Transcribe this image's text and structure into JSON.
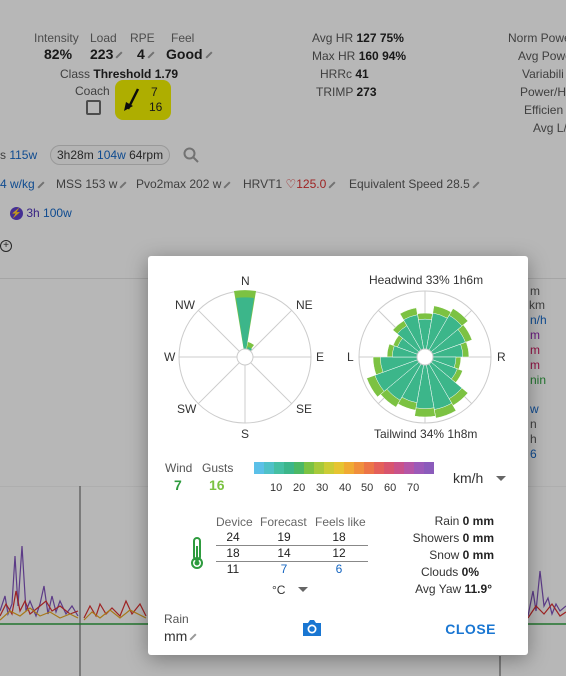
{
  "background": {
    "stats_left": [
      {
        "label": "Intensity",
        "value": "82%"
      },
      {
        "label": "Load",
        "value": "223"
      },
      {
        "label": "RPE",
        "value": "4"
      },
      {
        "label": "Feel",
        "value": "Good"
      }
    ],
    "class_label": "Class",
    "class_value": "Threshold 1.79",
    "coach_label": "Coach",
    "coach_arrow_top": "7",
    "coach_arrow_bottom": "16",
    "hr_rows": [
      {
        "label": "Avg HR",
        "v1": "127",
        "v2": "75%"
      },
      {
        "label": "Max HR",
        "v1": "160",
        "v2": "94%"
      },
      {
        "label": "HRRc",
        "v1": "41",
        "v2": ""
      },
      {
        "label": "TRIMP",
        "v1": "273",
        "v2": ""
      }
    ],
    "power_labels": [
      "Norm Powe",
      "Avg Powe",
      "Variabili",
      "Power/H",
      "Efficien",
      "Avg L/"
    ],
    "chip1_prefix": "s",
    "chip1_value": "115w",
    "chip2_time": "3h28m",
    "chip2_watts": "104w",
    "chip2_rpm": "64rpm",
    "metrics_row": [
      {
        "label": "",
        "value": "4 w/kg"
      },
      {
        "label": "MSS",
        "value": "153 w"
      },
      {
        "label": "Pvo2max",
        "value": "202 w"
      },
      {
        "label": "HRVT1",
        "value": "125.0"
      },
      {
        "label": "Equivalent Speed",
        "value": "28.5"
      }
    ],
    "power_badge_time": "3h",
    "power_badge_watts": "100w",
    "right_side_fragments": [
      "m",
      "km",
      "n/h",
      "m",
      "m",
      "m",
      "nin",
      "w",
      "n",
      "h",
      "6"
    ]
  },
  "dialog": {
    "compass": {
      "N": "N",
      "NE": "NE",
      "E": "E",
      "SE": "SE",
      "S": "S",
      "SW": "SW",
      "W": "W",
      "NW": "NW"
    },
    "relative": {
      "headwind": "Headwind 33% 1h6m",
      "tailwind": "Tailwind 34% 1h8m",
      "left": "L",
      "right": "R"
    },
    "wind_label": "Wind",
    "wind_value": "7",
    "gusts_label": "Gusts",
    "gusts_value": "16",
    "scale_ticks": [
      "10",
      "20",
      "30",
      "40",
      "50",
      "60",
      "70"
    ],
    "unit": "km/h",
    "temp_headers": [
      "Device",
      "Forecast",
      "Feels like"
    ],
    "temp_rows": [
      [
        "24",
        "19",
        "18"
      ],
      [
        "18",
        "14",
        "12"
      ],
      [
        "11",
        "7",
        "6"
      ]
    ],
    "temp_unit": "°C",
    "conditions": [
      {
        "label": "Rain",
        "value": "0 mm"
      },
      {
        "label": "Showers",
        "value": "0 mm"
      },
      {
        "label": "Snow",
        "value": "0 mm"
      },
      {
        "label": "Clouds",
        "value": "0%"
      },
      {
        "label": "Avg Yaw",
        "value": "11.9°"
      }
    ],
    "rain_label": "Rain",
    "rain_unit": "mm",
    "close_label": "CLOSE",
    "colors": {
      "wind": "#2e9b3e",
      "gusts": "#7cc242",
      "rose_fill": "#3cb68a",
      "accent": "#1976d2",
      "coach_highlight": "#e8e800"
    }
  }
}
